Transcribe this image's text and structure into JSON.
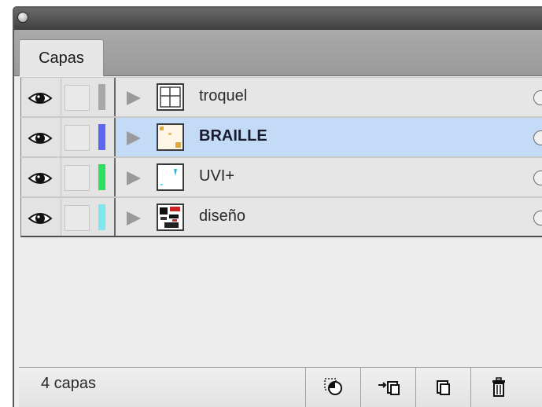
{
  "panel": {
    "tab_label": "Capas"
  },
  "layers": [
    {
      "name": "troquel",
      "color": "#a8a8a8",
      "selected": false
    },
    {
      "name": "BRAILLE",
      "color": "#5b67f0",
      "selected": true
    },
    {
      "name": "UVI+",
      "color": "#2ee060",
      "selected": false
    },
    {
      "name": "diseño",
      "color": "#7ee8ee",
      "selected": false
    }
  ],
  "status": {
    "count_label": "4 capas"
  },
  "icons": {
    "close": "close-icon",
    "visibility": "eye-icon",
    "expand": "triangle-right-icon",
    "target": "circle-icon",
    "clipping_mask": "clipping-mask-icon",
    "new_sublayer": "new-sublayer-icon",
    "new_layer": "new-layer-icon",
    "delete": "trash-icon"
  }
}
